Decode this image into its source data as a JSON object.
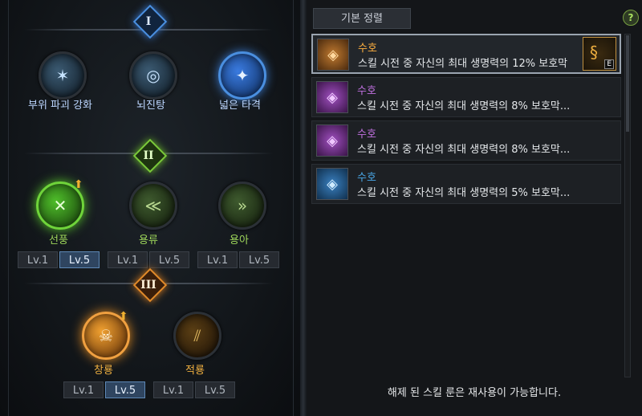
{
  "tiers": [
    {
      "numeral": "I",
      "color": "#4a8fe0"
    },
    {
      "numeral": "II",
      "color": "#7ac83a"
    },
    {
      "numeral": "III",
      "color": "#e08a2a"
    }
  ],
  "skills_tier1": [
    {
      "name": "부위 파괴 강화",
      "label_color": "#bcd6ff",
      "icon": "shatter-icon"
    },
    {
      "name": "뇌진탕",
      "label_color": "#bcd6ff",
      "icon": "concussion-icon"
    },
    {
      "name": "넓은 타격",
      "label_color": "#bcd6ff",
      "icon": "wide-strike-icon"
    }
  ],
  "skills_tier2": [
    {
      "name": "선풍",
      "label_color": "#9ed65a",
      "icon": "whirlwind-icon",
      "upgrade": true
    },
    {
      "name": "용류",
      "label_color": "#9ed65a",
      "icon": "dragon-flow-icon",
      "upgrade": false
    },
    {
      "name": "용아",
      "label_color": "#9ed65a",
      "icon": "dragon-fang-icon",
      "upgrade": false
    }
  ],
  "skills_tier3": [
    {
      "name": "창룡",
      "label_color": "#f0b040",
      "icon": "skull-icon",
      "upgrade": true
    },
    {
      "name": "적룡",
      "label_color": "#f0b040",
      "icon": "red-dragon-icon",
      "upgrade": false
    }
  ],
  "level_buttons": {
    "lv1": "Lv.1",
    "lv5": "Lv.5"
  },
  "right": {
    "sort_label": "기본 정렬",
    "help_label": "?",
    "footer": "해제 된 스킬 룬은 재사용이 가능합니다.",
    "runes": [
      {
        "name": "수호",
        "name_color": "#ffb040",
        "desc": "스킬 시전 중 자신의 최대 생명력의 12% 보호막",
        "frame_color": "#c07a30",
        "equipped": true,
        "equip_key": "E"
      },
      {
        "name": "수호",
        "name_color": "#c070e0",
        "desc": "스킬 시전 중 자신의 최대 생명력의 8% 보호막...",
        "frame_color": "#7a3a9a",
        "equipped": false
      },
      {
        "name": "수호",
        "name_color": "#c070e0",
        "desc": "스킬 시전 중 자신의 최대 생명력의 8% 보호막...",
        "frame_color": "#7a3a9a",
        "equipped": false
      },
      {
        "name": "수호",
        "name_color": "#4aa8e8",
        "desc": "스킬 시전 중 자신의 최대 생명력의 5% 보호막...",
        "frame_color": "#2a5a8a",
        "equipped": false
      }
    ]
  }
}
